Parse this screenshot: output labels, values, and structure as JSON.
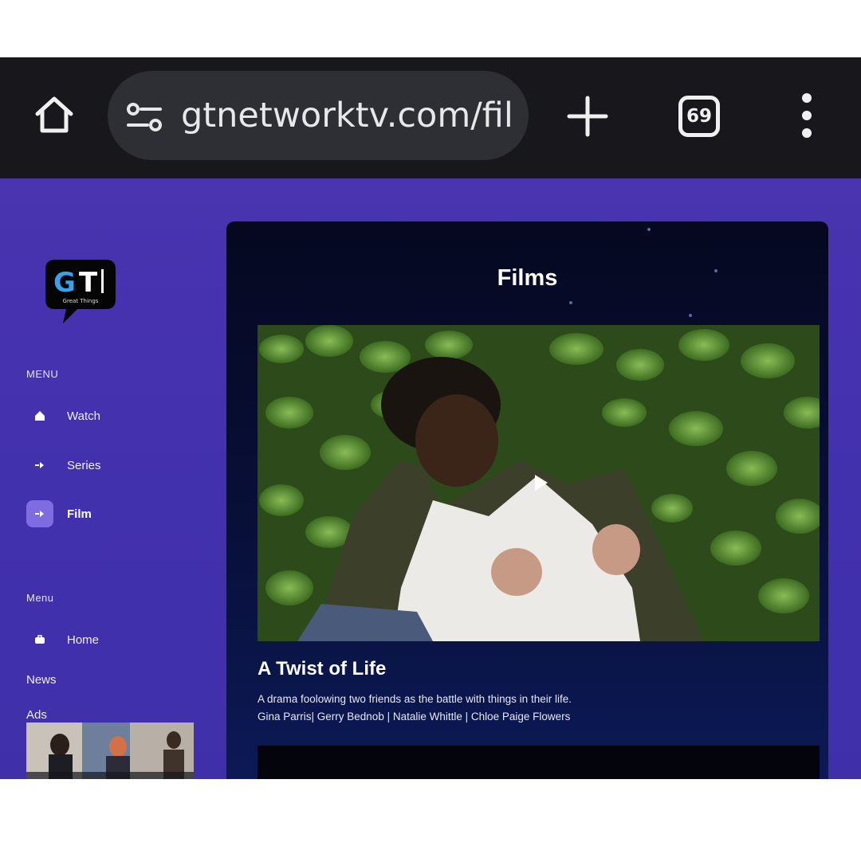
{
  "browser": {
    "url": "gtnetworktv.com/film",
    "tab_count": "69",
    "icons": [
      "home-icon",
      "tune-icon",
      "plus-icon",
      "tabs-icon",
      "more-vert-icon"
    ],
    "bar_color": "#18181c"
  },
  "sidebar": {
    "logo_text": "GT",
    "logo_subtext": "Great Things",
    "menu_heading": "MENU",
    "items": [
      {
        "label": "Watch",
        "icon": "home-icon",
        "active": false
      },
      {
        "label": "Series",
        "icon": "arrow-right-icon",
        "active": false
      },
      {
        "label": "Film",
        "icon": "arrow-right-icon",
        "active": true
      }
    ],
    "menu2_heading": "Menu",
    "home_label": "Home",
    "news_label": "News",
    "ads_label": "Ads"
  },
  "main": {
    "title": "Films",
    "film": {
      "title": "A Twist of Life",
      "description": "A drama foolowing two friends as the battle with things in their life.",
      "cast": "Gina Parris| Gerry Bednob | Natalie Whittle | Chloe Paige Flowers"
    }
  },
  "colors": {
    "page_bg": "#4331ad",
    "panel_bg": "#08103a",
    "active_item": "#7e6ce0"
  }
}
